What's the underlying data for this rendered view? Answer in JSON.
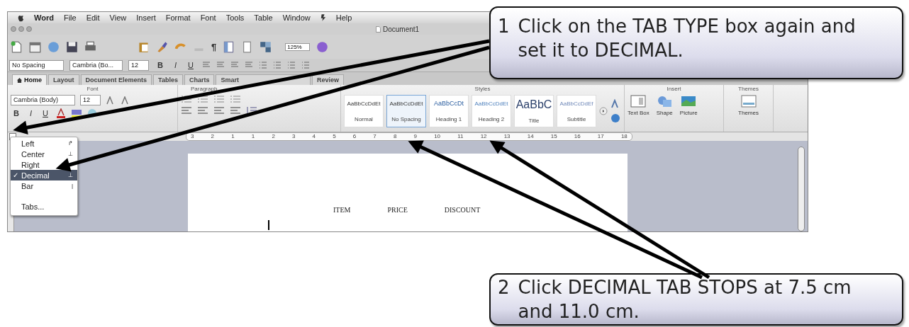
{
  "menu_bar": {
    "app_name": "Word",
    "items": [
      "File",
      "Edit",
      "View",
      "Insert",
      "Format",
      "Font",
      "Tools",
      "Table",
      "Window"
    ],
    "help": "Help"
  },
  "window": {
    "title": "Document1"
  },
  "toolbar": {
    "pilcrow": "¶",
    "zoom": "125%"
  },
  "format_bar": {
    "style": "No Spacing",
    "font": "Cambria (Bo...",
    "size": "12",
    "buttons": [
      "B",
      "I",
      "U"
    ]
  },
  "ribbon_tabs": [
    {
      "label": "Home",
      "selected": true
    },
    {
      "label": "Layout",
      "selected": false
    },
    {
      "label": "Document Elements",
      "selected": false
    },
    {
      "label": "Tables",
      "selected": false
    },
    {
      "label": "Charts",
      "selected": false
    },
    {
      "label": "Smart",
      "selected": false
    },
    {
      "label": "Review",
      "selected": false
    }
  ],
  "groups": {
    "font": "Font",
    "paragraph": "Paragraph",
    "styles": "Styles",
    "insert": "Insert",
    "themes": "Themes"
  },
  "font_group": {
    "font": "Cambria (Body)",
    "size": "12",
    "buttons": [
      "B",
      "I",
      "U"
    ]
  },
  "styles": [
    {
      "sample": "AaBbCcDdEt",
      "name": "Normal",
      "selected": false
    },
    {
      "sample": "AaBbCcDdEt",
      "name": "No Spacing",
      "selected": true
    },
    {
      "sample": "AaBbCcDt",
      "name": "Heading 1",
      "selected": false
    },
    {
      "sample": "AaBbCcDdEt",
      "name": "Heading 2",
      "selected": false
    },
    {
      "sample": "AaBbC",
      "name": "Title",
      "selected": false
    },
    {
      "sample": "AaBbCcDdEf",
      "name": "Subtitle",
      "selected": false
    }
  ],
  "insert_items": [
    "Text Box",
    "Shape",
    "Picture"
  ],
  "themes_item": "Themes",
  "ruler": [
    "3",
    "2",
    "1",
    "1",
    "2",
    "3",
    "4",
    "5",
    "6",
    "7",
    "8",
    "9",
    "10",
    "11",
    "12",
    "13",
    "14",
    "15",
    "16",
    "17",
    "18"
  ],
  "tab_menu_check": "✓",
  "tab_menu": [
    {
      "label": "Left",
      "mark": "↱",
      "selected": false
    },
    {
      "label": "Center",
      "mark": "⊥",
      "selected": false
    },
    {
      "label": "Right",
      "selected": false
    },
    {
      "label": "Decimal",
      "mark": "⊥",
      "selected": true
    },
    {
      "label": "Bar",
      "mark": "|",
      "selected": false
    },
    {
      "label": "Tabs...",
      "selected": false,
      "kind": "gap"
    }
  ],
  "document": {
    "headings": [
      "ITEM",
      "PRICE",
      "DISCOUNT"
    ]
  },
  "callouts": [
    {
      "number": "1",
      "text": "Click on the TAB TYPE box again and set it to DECIMAL."
    },
    {
      "number": "2",
      "text": "Click DECIMAL TAB STOPS at 7.5 cm and 11.0 cm."
    }
  ]
}
